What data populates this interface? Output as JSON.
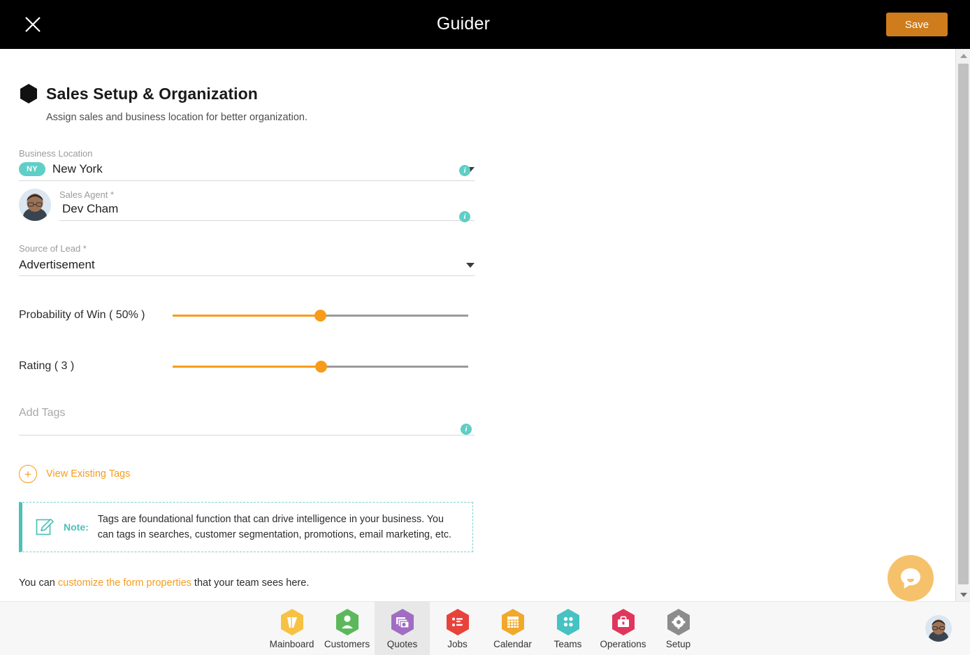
{
  "topbar": {
    "title": "Guider",
    "save_label": "Save",
    "close_icon": "close-icon"
  },
  "section": {
    "title": "Sales Setup & Organization",
    "subtitle": "Assign sales and business location for better organization."
  },
  "fields": {
    "business_location": {
      "label": "Business Location",
      "badge": "NY",
      "value": "New York",
      "has_dropdown": true,
      "has_info": true
    },
    "sales_agent": {
      "label": "Sales Agent *",
      "value": "Dev Cham",
      "has_info": true
    },
    "source_of_lead": {
      "label": "Source of Lead *",
      "value": "Advertisement",
      "has_dropdown": true
    },
    "add_tags": {
      "placeholder": "Add Tags",
      "value": "",
      "has_info": true
    }
  },
  "sliders": [
    {
      "label": "Probability of Win ( 50% )",
      "value": 50,
      "min": 0,
      "max": 100
    },
    {
      "label": "Rating ( 3 )",
      "value": 3,
      "min": 0,
      "max": 6
    }
  ],
  "view_tags": {
    "label": "View Existing Tags",
    "icon": "plus-circle-icon"
  },
  "note": {
    "icon": "edit-note-icon",
    "word": "Note:",
    "text": "Tags are foundational function that can drive intelligence in your business. You can tags in searches, customer segmentation, promotions, email marketing, etc."
  },
  "footer": {
    "prefix": "You can ",
    "link": "customize the form properties",
    "suffix": " that your team sees here."
  },
  "chat": {
    "icon": "chat-bubble-icon"
  },
  "bottom_nav": {
    "active": "Quotes",
    "items": [
      {
        "label": "Mainboard",
        "icon": "mainboard-icon",
        "color": "#f7c244"
      },
      {
        "label": "Customers",
        "icon": "customers-icon",
        "color": "#5cb85c"
      },
      {
        "label": "Quotes",
        "icon": "quotes-icon",
        "color": "#a06cc4"
      },
      {
        "label": "Jobs",
        "icon": "jobs-icon",
        "color": "#e8433b"
      },
      {
        "label": "Calendar",
        "icon": "calendar-icon",
        "color": "#f0a92b"
      },
      {
        "label": "Teams",
        "icon": "teams-icon",
        "color": "#46c2c2"
      },
      {
        "label": "Operations",
        "icon": "operations-icon",
        "color": "#e0365c"
      },
      {
        "label": "Setup",
        "icon": "setup-icon",
        "color": "#8c8c8c"
      }
    ]
  },
  "colors": {
    "accent_orange": "#f79c1a",
    "save_button": "#cf7c1c",
    "teal": "#5ecfc6",
    "topbar_bg": "#000000"
  },
  "scrollbar": {
    "position": "top"
  }
}
